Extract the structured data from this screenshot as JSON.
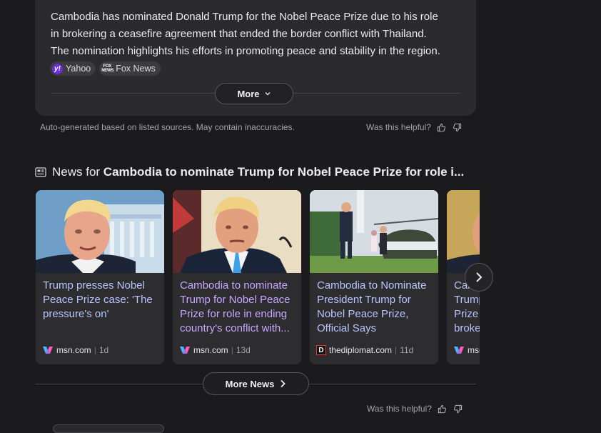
{
  "summary": {
    "lines": [
      "Cambodia has nominated Donald Trump for the Nobel Peace Prize due to his role",
      "in brokering a ceasefire agreement that ended the border conflict with Thailand.",
      "The nomination highlights his efforts in promoting peace and stability in the region."
    ],
    "sources": [
      {
        "label": "Yahoo",
        "icon": "yahoo-icon"
      },
      {
        "label": "Fox News",
        "icon": "fox-news-icon"
      }
    ],
    "more_label": "More",
    "disclaimer": "Auto-generated based on listed sources. May contain inaccuracies.",
    "helpful_label": "Was this helpful?"
  },
  "news": {
    "heading_prefix": "News for ",
    "heading_query": "Cambodia to nominate Trump for Nobel Peace Prize for role i...",
    "cards": [
      {
        "title": "Trump presses Nobel Peace Prize case: 'The pressure's on'",
        "source": "msn.com",
        "age": "1d",
        "icon": "msn-icon",
        "visited": false
      },
      {
        "title": "Cambodia to nominate Trump for Nobel Peace Prize for role in ending country's conflict with...",
        "source": "msn.com",
        "age": "13d",
        "icon": "msn-icon",
        "visited": true
      },
      {
        "title": "Cambodia to Nominate President Trump for Nobel Peace Prize, Official Says",
        "source": "thediplomat.com",
        "age": "11d",
        "icon": "thediplomat-icon",
        "visited": false
      },
      {
        "title": "Cambodia nominates Trump for Nobel Peace Prize for role in brokering",
        "source": "msn.com",
        "age": "",
        "icon": "msn-icon",
        "visited": false
      }
    ],
    "more_news_label": "More News",
    "helpful_label": "Was this helpful?"
  },
  "colors": {
    "background": "#1b1b1d",
    "card": "#2d2d30",
    "link": "#b9c6ff",
    "visited_link": "#c7a7ff"
  }
}
